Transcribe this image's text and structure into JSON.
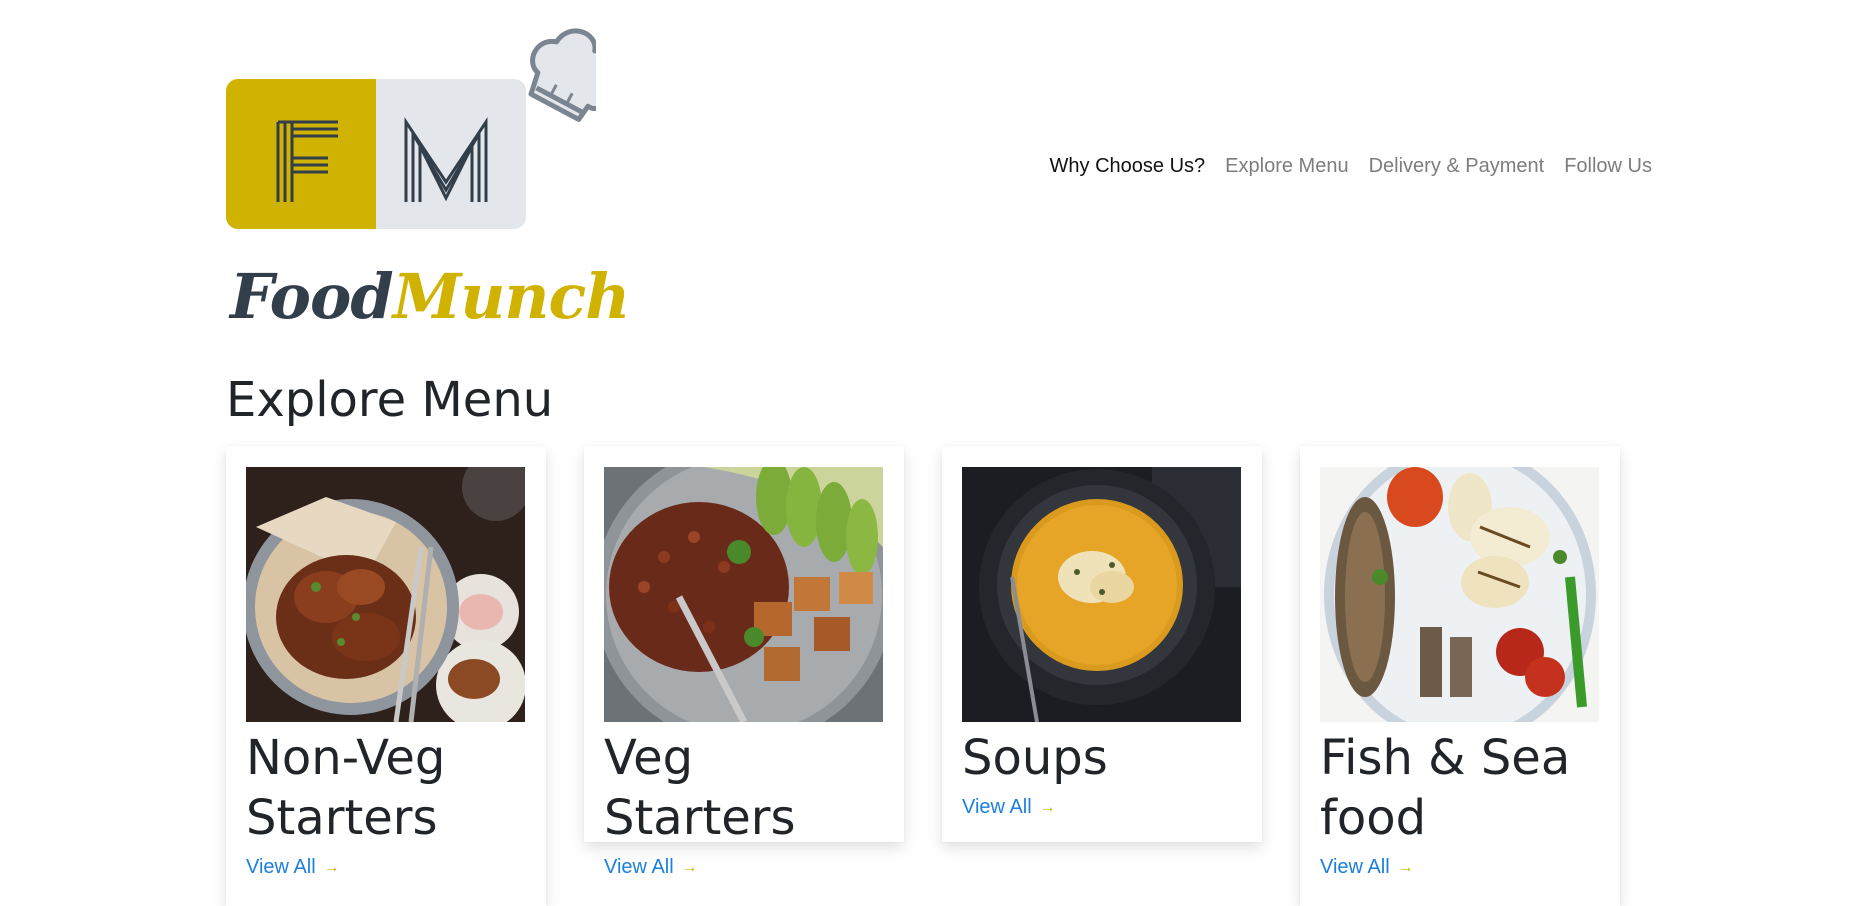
{
  "logo": {
    "letters": [
      "F",
      "M"
    ],
    "brand_food": "Food",
    "brand_munch": "Munch"
  },
  "nav": {
    "items": [
      {
        "label": "Why Choose Us?"
      },
      {
        "label": "Explore Menu"
      },
      {
        "label": "Delivery & Payment"
      },
      {
        "label": "Follow Us"
      }
    ]
  },
  "explore": {
    "title": "Explore Menu",
    "cards": [
      {
        "title": "Non-Veg Starters",
        "link": "View All",
        "image": "fried-chicken-image"
      },
      {
        "title": "Veg Starters",
        "link": "View All",
        "image": "tofu-avocado-bowl-image"
      },
      {
        "title": "Soups",
        "link": "View All",
        "image": "pumpkin-soup-image"
      },
      {
        "title": "Fish & Sea food",
        "link": "View All",
        "image": "seafood-platter-image"
      }
    ]
  },
  "colors": {
    "accent_yellow": "#d0b200",
    "slate": "#323f4b",
    "link_blue": "#1a7fe0"
  }
}
